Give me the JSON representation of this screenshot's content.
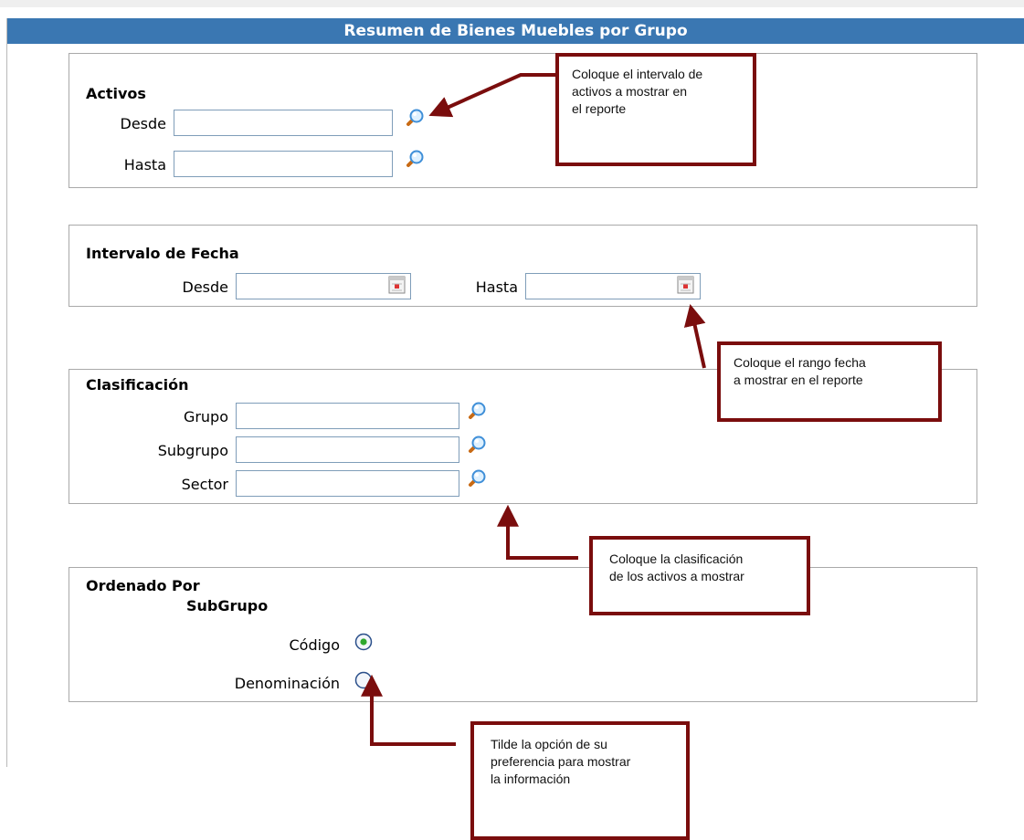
{
  "header": {
    "title": "Resumen de Bienes Muebles por Grupo"
  },
  "activos": {
    "title": "Activos",
    "desde_label": "Desde",
    "hasta_label": "Hasta",
    "desde_value": "",
    "hasta_value": ""
  },
  "fecha": {
    "title": "Intervalo de Fecha",
    "desde_label": "Desde",
    "hasta_label": "Hasta",
    "desde_value": "",
    "hasta_value": ""
  },
  "clasificacion": {
    "title": "Clasificación",
    "grupo_label": "Grupo",
    "subgrupo_label": "Subgrupo",
    "sector_label": "Sector",
    "grupo_value": "",
    "subgrupo_value": "",
    "sector_value": ""
  },
  "orden": {
    "title": "Ordenado Por",
    "subtitle": "SubGrupo",
    "codigo_label": "Código",
    "denominacion_label": "Denominación",
    "selected": "Código"
  },
  "callouts": {
    "activos_line1": "Coloque el intervalo de",
    "activos_line2": "activos a  mostrar en",
    "activos_line3": "el reporte",
    "fecha_line1": "Coloque el  rango  fecha",
    "fecha_line2": "a  mostrar en el reporte",
    "clasificacion_line1": "Coloque la clasificación",
    "clasificacion_line2": "de los activos a mostrar",
    "orden_line1": "Tilde  la  opción  de  su",
    "orden_line2": "preferencia para mostrar",
    "orden_line3": "la información"
  },
  "colors": {
    "header_bg": "#3a77b2",
    "callout_border": "#7a0d0d",
    "panel_border": "#a9a9a9"
  },
  "icons": [
    "search-icon",
    "calendar-icon",
    "radio-selected-icon",
    "radio-unselected-icon"
  ]
}
